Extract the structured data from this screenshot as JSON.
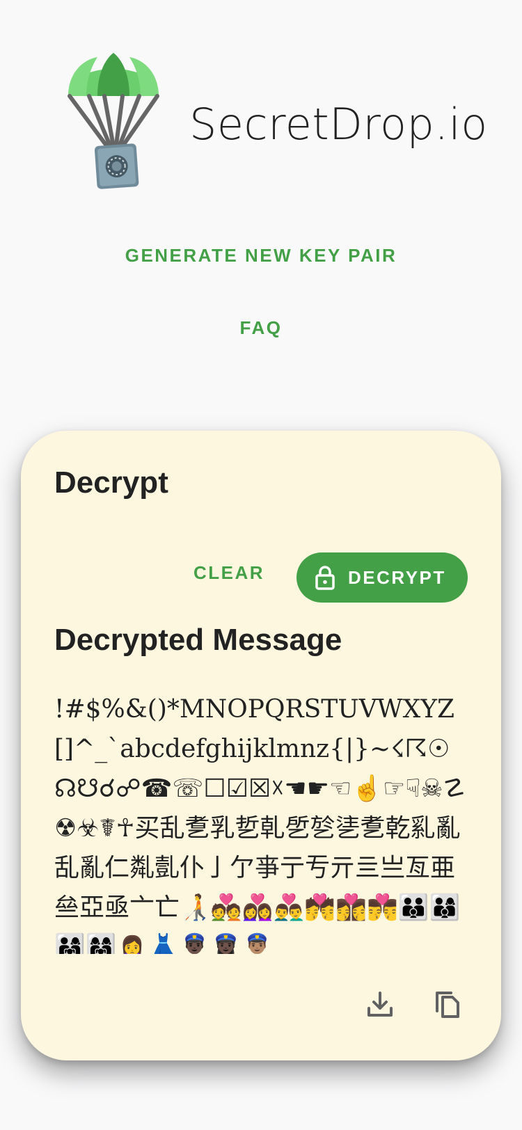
{
  "app": {
    "title": "SecretDrop.io",
    "logo_icon": "parachute-safe-icon"
  },
  "nav": {
    "generate_label": "GENERATE NEW KEY PAIR",
    "faq_label": "FAQ"
  },
  "card": {
    "title": "Decrypt",
    "clear_label": "CLEAR",
    "decrypt_label": "DECRYPT",
    "decrypt_icon": "lock-icon",
    "result_title": "Decrypted Message",
    "message": "!#$%&()*MNOPQRSTUVWXYZ[]^_`abcdefghijklmnz{|}~☇☈☉☊☋☌☍☎☏☐☑☒☓☚☛☜☝☞☟☠☡☢☣☤☥买乱乽乳乴乹乺乻乼乽乾乿亂乱亂仁亃亄仆亅亇亊亍亐亓亖亗亙亜亝亞亟亠亡🧑‍🦯💑👩‍❤️‍👩👨‍❤️‍👨💏👩‍❤️‍💋‍👩👨‍❤️‍💋‍👨👪👨‍👩‍👦👨‍👩‍👧👩‍👩‍👧🙍‍♀️👗👮🏿‍♂️👮🏿‍♀️👮🏽‍♂️",
    "download_icon": "download-icon",
    "copy_icon": "copy-icon"
  },
  "colors": {
    "accent": "#43a047",
    "card_bg": "#fef7e0",
    "page_bg": "#f9f9fa"
  }
}
